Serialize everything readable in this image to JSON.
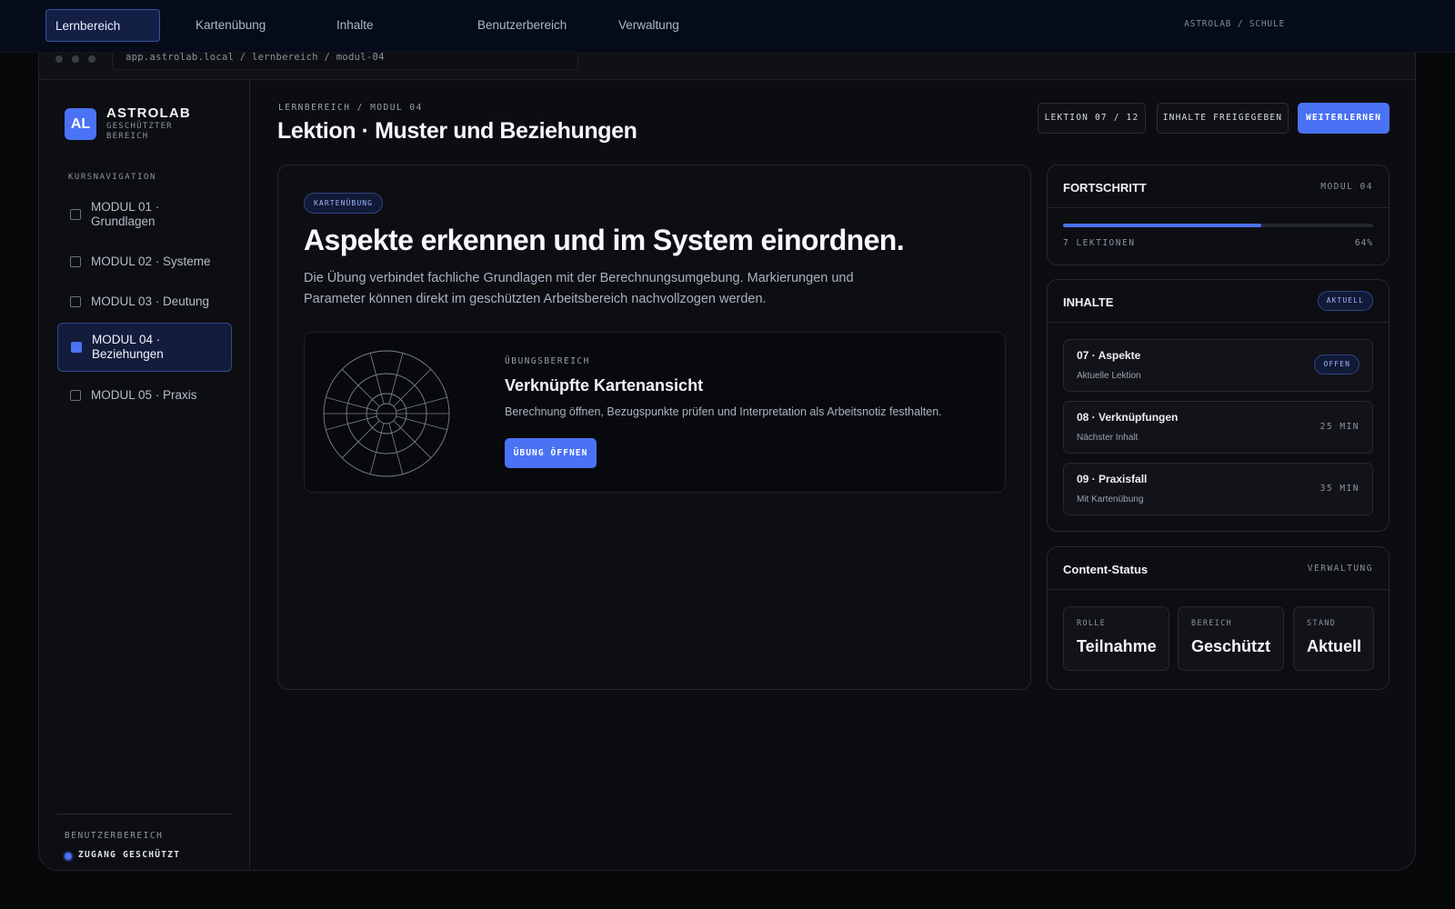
{
  "nav": {
    "items": [
      {
        "label": "Lernbereich",
        "active": true
      },
      {
        "label": "Kartenübung",
        "active": false
      },
      {
        "label": "Inhalte",
        "active": false
      },
      {
        "label": "Benutzerbereich",
        "active": false
      },
      {
        "label": "Verwaltung",
        "active": false
      }
    ],
    "brand": "ASTROLAB / SCHULE"
  },
  "browser": {
    "url": "app.astrolab.local / lernbereich / modul-04"
  },
  "sidebar": {
    "logo_initials": "AL",
    "brand_name": "ASTROLAB",
    "brand_sub": "GESCHÜTZTER BEREICH",
    "heading": "KURSNAVIGATION",
    "items": [
      {
        "label": "MODUL 01 · Grundlagen",
        "active": false
      },
      {
        "label": "MODUL 02 · Systeme",
        "active": false
      },
      {
        "label": "MODUL 03 · Deutung",
        "active": false
      },
      {
        "label": "MODUL 04 · Beziehungen",
        "active": true
      },
      {
        "label": "MODUL 05 · Praxis",
        "active": false
      }
    ],
    "footer_label": "BENUTZERBEREICH",
    "access_label": "ZUGANG GESCHÜTZT"
  },
  "header": {
    "breadcrumb": "LERNBEREICH / MODUL 04",
    "title": "Lektion · Muster und Beziehungen",
    "lesson_counter": "LEKTION 07 / 12",
    "released_label": "INHALTE FREIGEGEBEN",
    "continue_label": "WEITERLERNEN"
  },
  "hero": {
    "tag": "KARTENÜBUNG",
    "title": "Aspekte erkennen und im System einordnen.",
    "text": "Die Übung verbindet fachliche Grundlagen mit der Berechnungsumgebung. Markierungen und Parameter können direkt im geschützten Arbeitsbereich nachvollzogen werden.",
    "exercise": {
      "label": "ÜBUNGSBEREICH",
      "title": "Verknüpfte Kartenansicht",
      "text": "Berechnung öffnen, Bezugspunkte prüfen und Interpretation als Arbeitsnotiz festhalten.",
      "button": "ÜBUNG ÖFFNEN"
    }
  },
  "progress": {
    "title": "FORTSCHRITT",
    "module": "MODUL 04",
    "lessons": "7 LEKTIONEN",
    "percent_label": "64%",
    "percent": 64
  },
  "contents": {
    "title": "INHALTE",
    "badge": "AKTUELL",
    "items": [
      {
        "title": "07 · Aspekte",
        "subtitle": "Aktuelle Lektion",
        "badge": "OFFEN"
      },
      {
        "title": "08 · Verknüpfungen",
        "subtitle": "Nächster Inhalt",
        "meta": "25 MIN"
      },
      {
        "title": "09 · Praxisfall",
        "subtitle": "Mit Kartenübung",
        "meta": "35 MIN"
      }
    ]
  },
  "status": {
    "title": "Content-Status",
    "meta": "VERWALTUNG",
    "stats": [
      {
        "label": "ROLLE",
        "value": "Teilnahme"
      },
      {
        "label": "BEREICH",
        "value": "Geschützt"
      },
      {
        "label": "STAND",
        "value": "Aktuell"
      }
    ]
  },
  "colors": {
    "accent": "#4a72f5",
    "background": "#070809",
    "panel": "#0d0e12",
    "nav": "#060b1a"
  }
}
